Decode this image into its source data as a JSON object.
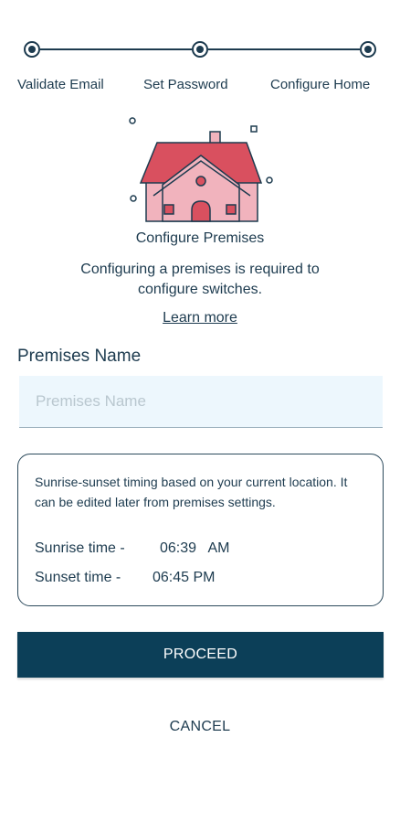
{
  "stepper": {
    "steps": [
      {
        "label": "Validate Email"
      },
      {
        "label": "Set Password"
      },
      {
        "label": "Configure Home"
      }
    ]
  },
  "header": {
    "title": "Configure Premises",
    "description": "Configuring a premises is required to configure switches.",
    "learn_more": "Learn more"
  },
  "premises_field": {
    "label": "Premises Name",
    "placeholder": "Premises Name",
    "value": ""
  },
  "timing_card": {
    "info": "Sunrise-sunset timing based on your current location. It can be edited later from premises settings.",
    "sunrise_label": "Sunrise time -",
    "sunrise_value": "06:39   AM",
    "sunset_label": "Sunset time -",
    "sunset_value": "06:45 PM"
  },
  "actions": {
    "proceed_label": "PROCEED",
    "cancel_label": "CANCEL"
  },
  "colors": {
    "primary": "#0c3f58",
    "text": "#1d3b4f",
    "input_bg": "#edf7fd",
    "roof": "#d9505f",
    "house_wall": "#f1b3bd"
  },
  "illustration": {
    "icon": "house-icon"
  }
}
